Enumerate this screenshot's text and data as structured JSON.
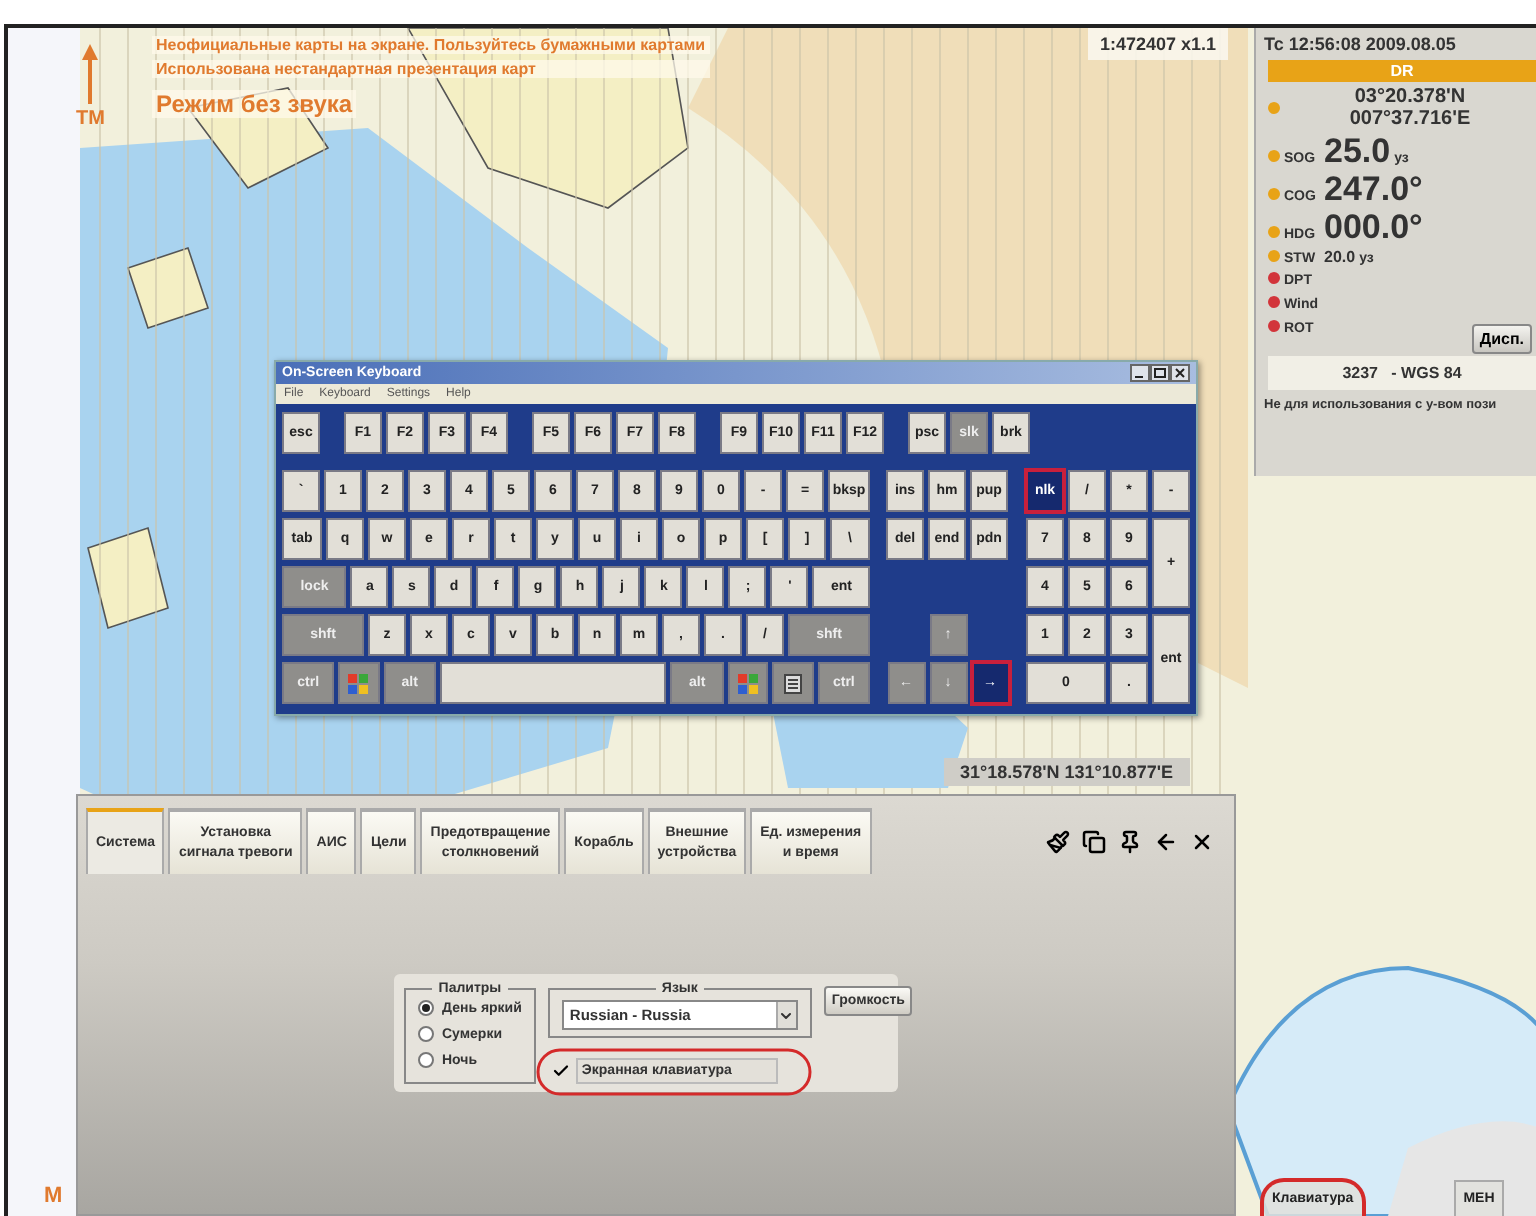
{
  "chart": {
    "warnings": [
      "Неофициальные карты на экране. Пользуйтесь бумажными картами",
      "Использована нестандартная презентация карт"
    ],
    "mode": "Режим без звука",
    "north_label": "TM",
    "scale": "1:472407 x1.1",
    "corner_label": "M",
    "cursor_position": "31°18.578'N 131°10.877'E"
  },
  "nav_panel": {
    "time": "Tc 12:56:08  2009.08.05",
    "source": "DR",
    "position": {
      "color": "#e8a317",
      "lat": "03°20.378'N",
      "lon": "007°37.716'E"
    },
    "sensors": [
      {
        "label": "SOG",
        "kind": "big",
        "value": "25.0",
        "unit": "уз",
        "color": "#e8a317"
      },
      {
        "label": "COG",
        "kind": "big",
        "value": "247.0°",
        "color": "#e8a317"
      },
      {
        "label": "HDG",
        "kind": "big",
        "value": "000.0°",
        "color": "#e8a317"
      },
      {
        "label": "STW",
        "kind": "small",
        "value": "20.0",
        "unit": "уз",
        "color": "#e8a317"
      },
      {
        "label": "DPT",
        "kind": "empty",
        "color": "#d2343a"
      },
      {
        "label": "Wind",
        "kind": "empty",
        "color": "#d2343a"
      },
      {
        "label": "ROT",
        "kind": "empty",
        "color": "#d2343a"
      }
    ],
    "display_button": "Дисп.",
    "datum": "3237   - WGS 84",
    "notice": "Не для использования с у-вом пози"
  },
  "keyboard": {
    "title": "On-Screen Keyboard",
    "menu": [
      "File",
      "Keyboard",
      "Settings",
      "Help"
    ],
    "function_row": [
      [
        {
          "label": "esc",
          "kind": "key"
        }
      ],
      [
        {
          "label": "F1",
          "kind": "key"
        },
        {
          "label": "F2",
          "kind": "key"
        },
        {
          "label": "F3",
          "kind": "key"
        },
        {
          "label": "F4",
          "kind": "key"
        }
      ],
      [
        {
          "label": "F5",
          "kind": "key"
        },
        {
          "label": "F6",
          "kind": "key"
        },
        {
          "label": "F7",
          "kind": "key"
        },
        {
          "label": "F8",
          "kind": "key"
        }
      ],
      [
        {
          "label": "F9",
          "kind": "key"
        },
        {
          "label": "F10",
          "kind": "key"
        },
        {
          "label": "F11",
          "kind": "key"
        },
        {
          "label": "F12",
          "kind": "key"
        }
      ],
      [
        {
          "label": "psc",
          "kind": "key"
        },
        {
          "label": "slk",
          "kind": "mod"
        },
        {
          "label": "brk",
          "kind": "key"
        }
      ]
    ],
    "main_rows": [
      [
        {
          "label": "`",
          "kind": "key"
        },
        {
          "label": "1",
          "kind": "key"
        },
        {
          "label": "2",
          "kind": "key"
        },
        {
          "label": "3",
          "kind": "key"
        },
        {
          "label": "4",
          "kind": "key"
        },
        {
          "label": "5",
          "kind": "key"
        },
        {
          "label": "6",
          "kind": "key"
        },
        {
          "label": "7",
          "kind": "key"
        },
        {
          "label": "8",
          "kind": "key"
        },
        {
          "label": "9",
          "kind": "key"
        },
        {
          "label": "0",
          "kind": "key"
        },
        {
          "label": "-",
          "kind": "key"
        },
        {
          "label": "=",
          "kind": "key"
        },
        {
          "label": "bksp",
          "kind": "wide"
        }
      ],
      [
        {
          "label": "tab",
          "kind": "wide"
        },
        {
          "label": "q",
          "kind": "key"
        },
        {
          "label": "w",
          "kind": "key"
        },
        {
          "label": "e",
          "kind": "key"
        },
        {
          "label": "r",
          "kind": "key"
        },
        {
          "label": "t",
          "kind": "key"
        },
        {
          "label": "y",
          "kind": "key"
        },
        {
          "label": "u",
          "kind": "key"
        },
        {
          "label": "i",
          "kind": "key"
        },
        {
          "label": "o",
          "kind": "key"
        },
        {
          "label": "p",
          "kind": "key"
        },
        {
          "label": "[",
          "kind": "key"
        },
        {
          "label": "]",
          "kind": "key"
        },
        {
          "label": "\\",
          "kind": "wide"
        }
      ],
      [
        {
          "label": "lock",
          "kind": "modwide"
        },
        {
          "label": "a",
          "kind": "key"
        },
        {
          "label": "s",
          "kind": "key"
        },
        {
          "label": "d",
          "kind": "key"
        },
        {
          "label": "f",
          "kind": "key"
        },
        {
          "label": "g",
          "kind": "key"
        },
        {
          "label": "h",
          "kind": "key"
        },
        {
          "label": "j",
          "kind": "key"
        },
        {
          "label": "k",
          "kind": "key"
        },
        {
          "label": "l",
          "kind": "key"
        },
        {
          "label": ";",
          "kind": "key"
        },
        {
          "label": "'",
          "kind": "key"
        },
        {
          "label": "ent",
          "kind": "wide"
        }
      ],
      [
        {
          "label": "shft",
          "kind": "modwide"
        },
        {
          "label": "z",
          "kind": "key"
        },
        {
          "label": "x",
          "kind": "key"
        },
        {
          "label": "c",
          "kind": "key"
        },
        {
          "label": "v",
          "kind": "key"
        },
        {
          "label": "b",
          "kind": "key"
        },
        {
          "label": "n",
          "kind": "key"
        },
        {
          "label": "m",
          "kind": "key"
        },
        {
          "label": ",",
          "kind": "key"
        },
        {
          "label": ".",
          "kind": "key"
        },
        {
          "label": "/",
          "kind": "key"
        },
        {
          "label": "shft",
          "kind": "modwide"
        }
      ],
      [
        {
          "label": "ctrl",
          "kind": "mod"
        },
        {
          "kind": "logo"
        },
        {
          "label": "alt",
          "kind": "mod"
        },
        {
          "kind": "space"
        },
        {
          "label": "alt",
          "kind": "mod"
        },
        {
          "kind": "logo"
        },
        {
          "kind": "menu"
        },
        {
          "label": "ctrl",
          "kind": "mod"
        }
      ]
    ],
    "nav_rows": [
      [
        {
          "label": "ins",
          "kind": "key"
        },
        {
          "label": "hm",
          "kind": "key"
        },
        {
          "label": "pup",
          "kind": "key"
        }
      ],
      [
        {
          "label": "del",
          "kind": "key"
        },
        {
          "label": "end",
          "kind": "key"
        },
        {
          "label": "pdn",
          "kind": "key"
        }
      ]
    ],
    "arrow_rows": [
      [
        {
          "label": "↑",
          "kind": "mod"
        }
      ],
      [
        {
          "label": "←",
          "kind": "mod"
        },
        {
          "label": "↓",
          "kind": "mod"
        },
        {
          "label": "→",
          "kind": "active"
        }
      ]
    ],
    "numpad": [
      {
        "label": "nlk",
        "kind": "active"
      },
      {
        "label": "/",
        "kind": "key"
      },
      {
        "label": "*",
        "kind": "key"
      },
      {
        "label": "-",
        "kind": "key"
      },
      {
        "label": "7",
        "kind": "key"
      },
      {
        "label": "8",
        "kind": "key"
      },
      {
        "label": "9",
        "kind": "key"
      },
      {
        "label": "+",
        "kind": "tall"
      },
      {
        "label": "4",
        "kind": "key"
      },
      {
        "label": "5",
        "kind": "key"
      },
      {
        "label": "6",
        "kind": "key"
      },
      {
        "label": "1",
        "kind": "key"
      },
      {
        "label": "2",
        "kind": "key"
      },
      {
        "label": "3",
        "kind": "key"
      },
      {
        "label": "ent",
        "kind": "tall"
      },
      {
        "label": "0",
        "kind": "double"
      },
      {
        "label": ".",
        "kind": "key"
      }
    ]
  },
  "settings": {
    "tabs": [
      {
        "label": "Система",
        "selected": true
      },
      {
        "label": "Установка\nсигнала тревоги",
        "selected": false
      },
      {
        "label": "АИС",
        "selected": false
      },
      {
        "label": "Цели",
        "selected": false
      },
      {
        "label": "Предотвращение\nстолкновений",
        "selected": false
      },
      {
        "label": "Корабль",
        "selected": false
      },
      {
        "label": "Внешние\nустройства",
        "selected": false
      },
      {
        "label": "Ед. измерения\nи время",
        "selected": false
      }
    ],
    "palettes": {
      "title": "Палитры",
      "options": [
        {
          "label": "День яркий",
          "selected": true
        },
        {
          "label": "Сумерки",
          "selected": false
        },
        {
          "label": "Ночь",
          "selected": false
        }
      ]
    },
    "language": {
      "title": "Язык",
      "value": "Russian - Russia"
    },
    "on_screen_keyboard": {
      "label": "Экранная клавиатура",
      "checked": true,
      "highlighted": true
    },
    "volume_button": "Громкость"
  },
  "bottom_buttons": [
    {
      "label": "Клавиатура",
      "highlighted": true
    },
    {
      "label": "МЕН",
      "highlighted": false
    }
  ]
}
